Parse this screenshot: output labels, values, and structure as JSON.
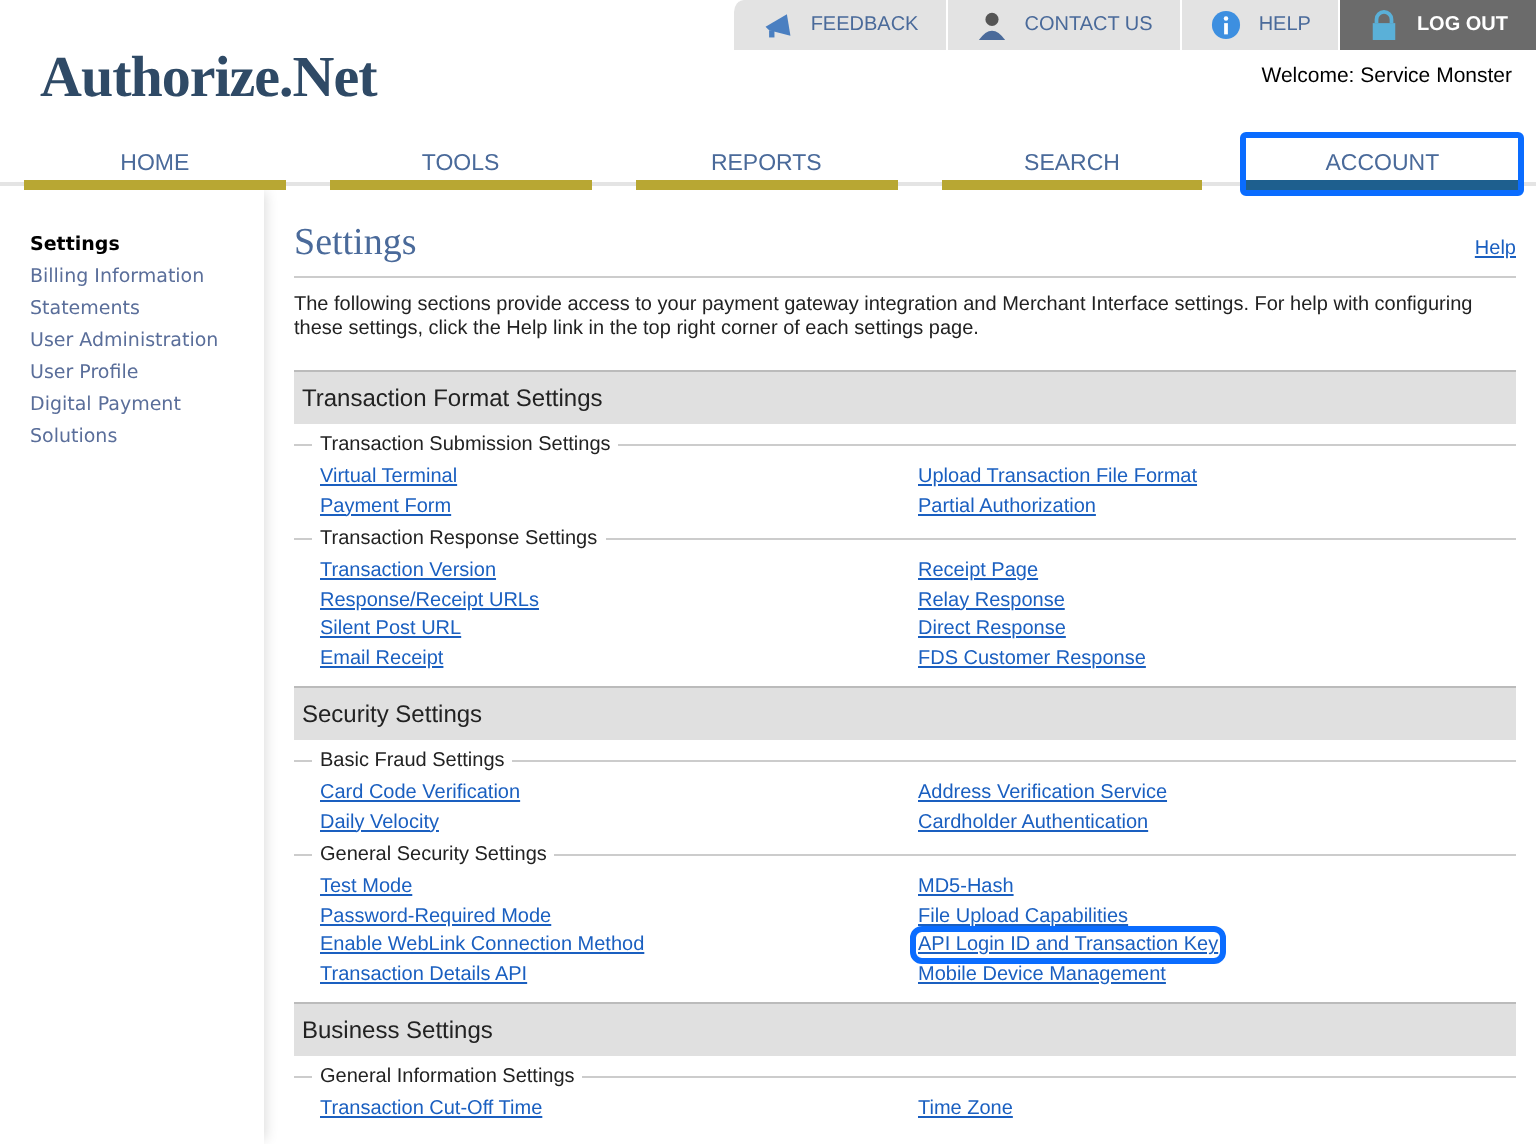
{
  "utility_bar": [
    {
      "label": "FEEDBACK",
      "kind": "megaphone",
      "selected": false
    },
    {
      "label": "CONTACT US",
      "kind": "person",
      "selected": false
    },
    {
      "label": "HELP",
      "kind": "info",
      "selected": false
    },
    {
      "label": "LOG OUT",
      "kind": "lock",
      "selected": true
    }
  ],
  "logo": "Authorize.Net",
  "welcome": "Welcome: Service Monster",
  "tabs": [
    {
      "label": "HOME",
      "selected": false,
      "highlighted": false
    },
    {
      "label": "TOOLS",
      "selected": false,
      "highlighted": false
    },
    {
      "label": "REPORTS",
      "selected": false,
      "highlighted": false
    },
    {
      "label": "SEARCH",
      "selected": false,
      "highlighted": false
    },
    {
      "label": "ACCOUNT",
      "selected": true,
      "highlighted": true
    }
  ],
  "sidebar": {
    "items": [
      {
        "label": "Settings",
        "selected": true
      },
      {
        "label": "Billing Information",
        "selected": false
      },
      {
        "label": "Statements",
        "selected": false
      },
      {
        "label": "User Administration",
        "selected": false
      },
      {
        "label": "User Profile",
        "selected": false
      },
      {
        "label": "Digital Payment Solutions",
        "selected": false
      }
    ]
  },
  "page": {
    "title": "Settings",
    "help": "Help",
    "intro": "The following sections provide access to your payment gateway integration and Merchant Interface settings. For help with configuring these settings, click the Help link in the top right corner of each settings page.",
    "sections": [
      {
        "title": "Transaction Format Settings",
        "groups": [
          {
            "title": "Transaction Submission Settings",
            "left": [
              {
                "label": "Virtual Terminal",
                "highlighted": false
              },
              {
                "label": "Payment Form",
                "highlighted": false
              }
            ],
            "right": [
              {
                "label": "Upload Transaction File Format",
                "highlighted": false
              },
              {
                "label": "Partial Authorization",
                "highlighted": false
              }
            ]
          },
          {
            "title": "Transaction Response Settings",
            "left": [
              {
                "label": "Transaction Version",
                "highlighted": false
              },
              {
                "label": "Response/Receipt URLs",
                "highlighted": false
              },
              {
                "label": "Silent Post URL",
                "highlighted": false
              },
              {
                "label": "Email Receipt",
                "highlighted": false
              }
            ],
            "right": [
              {
                "label": "Receipt Page",
                "highlighted": false
              },
              {
                "label": "Relay Response",
                "highlighted": false
              },
              {
                "label": "Direct Response",
                "highlighted": false
              },
              {
                "label": "FDS Customer Response",
                "highlighted": false
              }
            ]
          }
        ]
      },
      {
        "title": "Security Settings",
        "groups": [
          {
            "title": "Basic Fraud Settings",
            "left": [
              {
                "label": "Card Code Verification",
                "highlighted": false
              },
              {
                "label": "Daily Velocity",
                "highlighted": false
              }
            ],
            "right": [
              {
                "label": "Address Verification Service",
                "highlighted": false
              },
              {
                "label": "Cardholder Authentication",
                "highlighted": false
              }
            ]
          },
          {
            "title": "General Security Settings",
            "left": [
              {
                "label": "Test Mode",
                "highlighted": false
              },
              {
                "label": "Password-Required Mode",
                "highlighted": false
              },
              {
                "label": "Enable WebLink Connection Method",
                "highlighted": false
              },
              {
                "label": "Transaction Details API",
                "highlighted": false
              }
            ],
            "right": [
              {
                "label": "MD5-Hash",
                "highlighted": false
              },
              {
                "label": "File Upload Capabilities",
                "highlighted": false
              },
              {
                "label": "API Login ID and Transaction Key",
                "highlighted": true
              },
              {
                "label": "Mobile Device Management",
                "highlighted": false
              }
            ]
          }
        ]
      },
      {
        "title": "Business Settings",
        "groups": [
          {
            "title": "General Information Settings",
            "left": [
              {
                "label": "Transaction Cut-Off Time",
                "highlighted": false
              }
            ],
            "right": [
              {
                "label": "Time Zone",
                "highlighted": false
              }
            ]
          }
        ]
      }
    ]
  }
}
